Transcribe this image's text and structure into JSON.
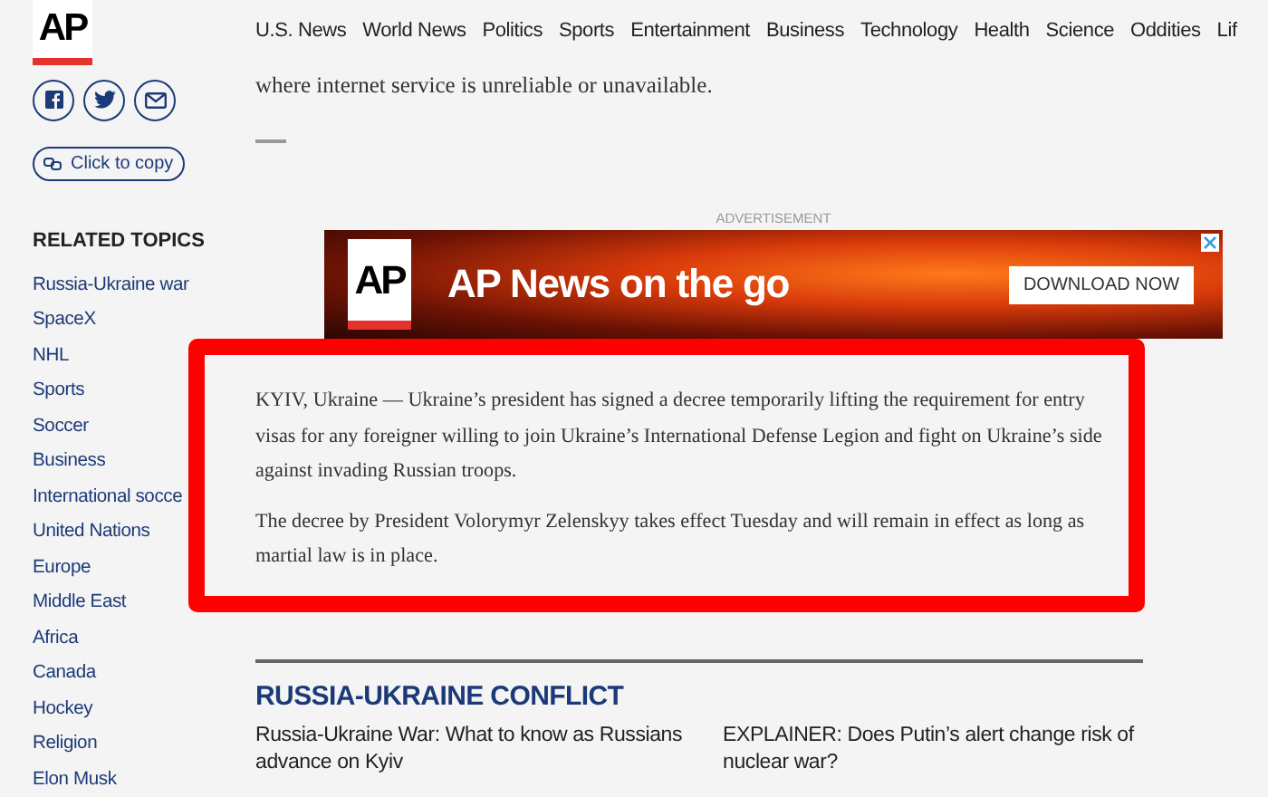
{
  "logo": {
    "text": "AP"
  },
  "nav": [
    "U.S. News",
    "World News",
    "Politics",
    "Sports",
    "Entertainment",
    "Business",
    "Technology",
    "Health",
    "Science",
    "Oddities",
    "Lif"
  ],
  "copy_button": "Click to copy",
  "related_topics": {
    "title": "RELATED TOPICS",
    "items": [
      "Russia-Ukraine war",
      "SpaceX",
      "NHL",
      "Sports",
      "Soccer",
      "Business",
      "International socce",
      "United Nations",
      "Europe",
      "Middle East",
      "Africa",
      "Canada",
      "Hockey",
      "Religion",
      "Elon Musk"
    ]
  },
  "intro_text": "where internet service is unreliable or unavailable.",
  "ad": {
    "label": "ADVERTISEMENT",
    "logo": "AP",
    "headline": "AP News on the go",
    "button": "DOWNLOAD NOW"
  },
  "article": [
    "KYIV, Ukraine — Ukraine’s president has signed a decree temporarily lifting the requirement for entry visas for any foreigner willing to join Ukraine’s International Defense Legion and fight on Ukraine’s side against invading Russian troops.",
    "The decree by President Volorymyr Zelenskyy takes effect Tuesday and will remain in effect as long as martial law is in place."
  ],
  "related_section": {
    "title": "RUSSIA-UKRAINE CONFLICT",
    "stories": [
      "Russia-Ukraine War: What to know as Russians advance on Kyiv",
      "EXPLAINER: Does Putin’s alert change risk of nuclear war?"
    ]
  }
}
